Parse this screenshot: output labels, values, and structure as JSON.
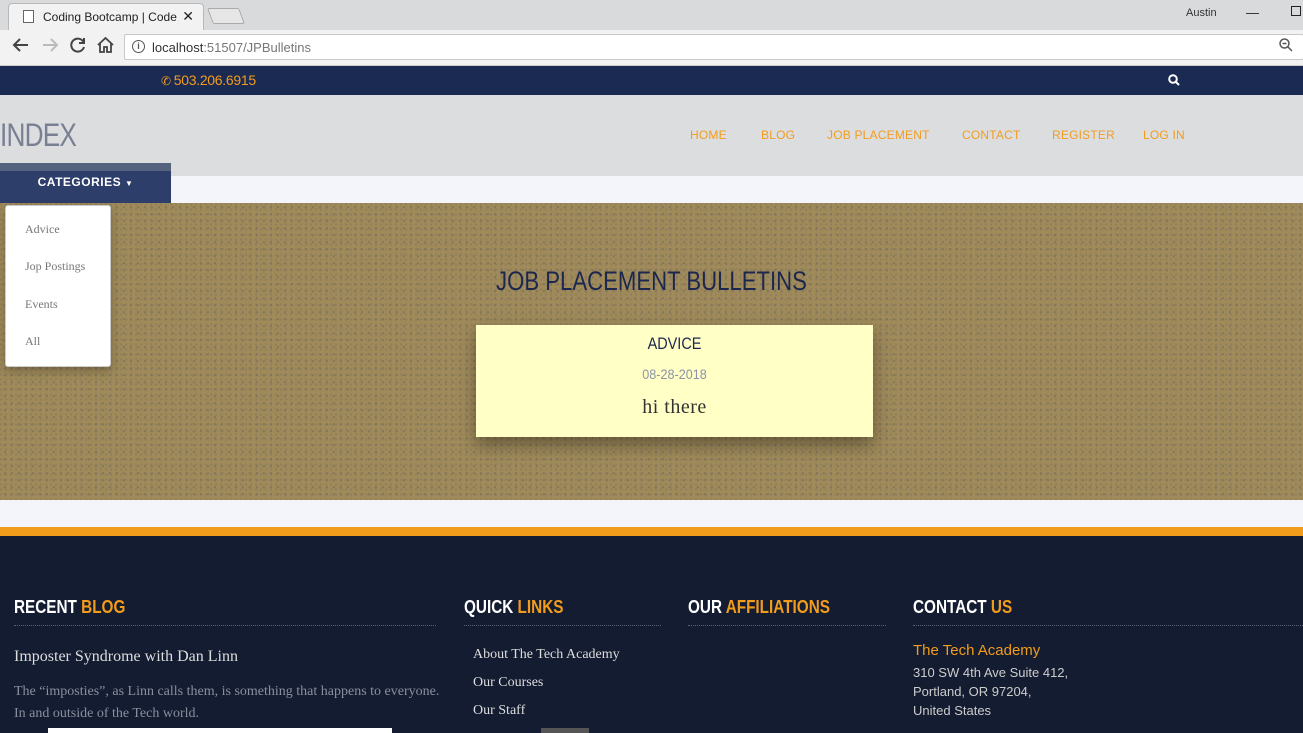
{
  "browser": {
    "tab_title": "Coding Bootcamp | Code",
    "tab_close": "✕",
    "user": "Austin",
    "url_host": "localhost",
    "url_rest": ":51507/JPBulletins",
    "icons": [
      "back-arrow-icon",
      "forward-arrow-icon",
      "reload-icon",
      "home-icon",
      "info-icon",
      "zoom-icon"
    ]
  },
  "topbar": {
    "phone": "503.206.6915",
    "accent": "#f29c1c",
    "bg": "#1b2a53"
  },
  "header": {
    "brand": "INDEX",
    "nav": [
      "HOME",
      "BLOG",
      "JOB PLACEMENT",
      "CONTACT",
      "REGISTER",
      "LOG IN"
    ]
  },
  "categories": {
    "label": "CATEGORIES",
    "items": [
      "Advice",
      "Jop Postings",
      "Events",
      "All"
    ]
  },
  "hero": {
    "title": "JOB PLACEMENT BULLETINS",
    "card": {
      "category": "ADVICE",
      "date": "08-28-2018",
      "body": "hi there"
    }
  },
  "footer": {
    "blog": {
      "head_a": "RECENT ",
      "head_b": "BLOG",
      "post_title": "Imposter Syndrome with Dan Linn",
      "post_text": "The “imposties”, as Linn calls them, is something that happens to everyone. In and outside of the Tech world."
    },
    "links": {
      "head_a": "QUICK ",
      "head_b": "LINKS",
      "items": [
        "About The Tech Academy",
        "Our Courses",
        "Our Staff"
      ]
    },
    "affiliations": {
      "head_a": "OUR ",
      "head_b": "AFFILIATIONS"
    },
    "contact": {
      "head_a": "CONTACT ",
      "head_b": "US",
      "name": "The Tech Academy",
      "lines": [
        "310 SW 4th Ave Suite 412,",
        "Portland, OR 97204,",
        "United States"
      ]
    }
  }
}
